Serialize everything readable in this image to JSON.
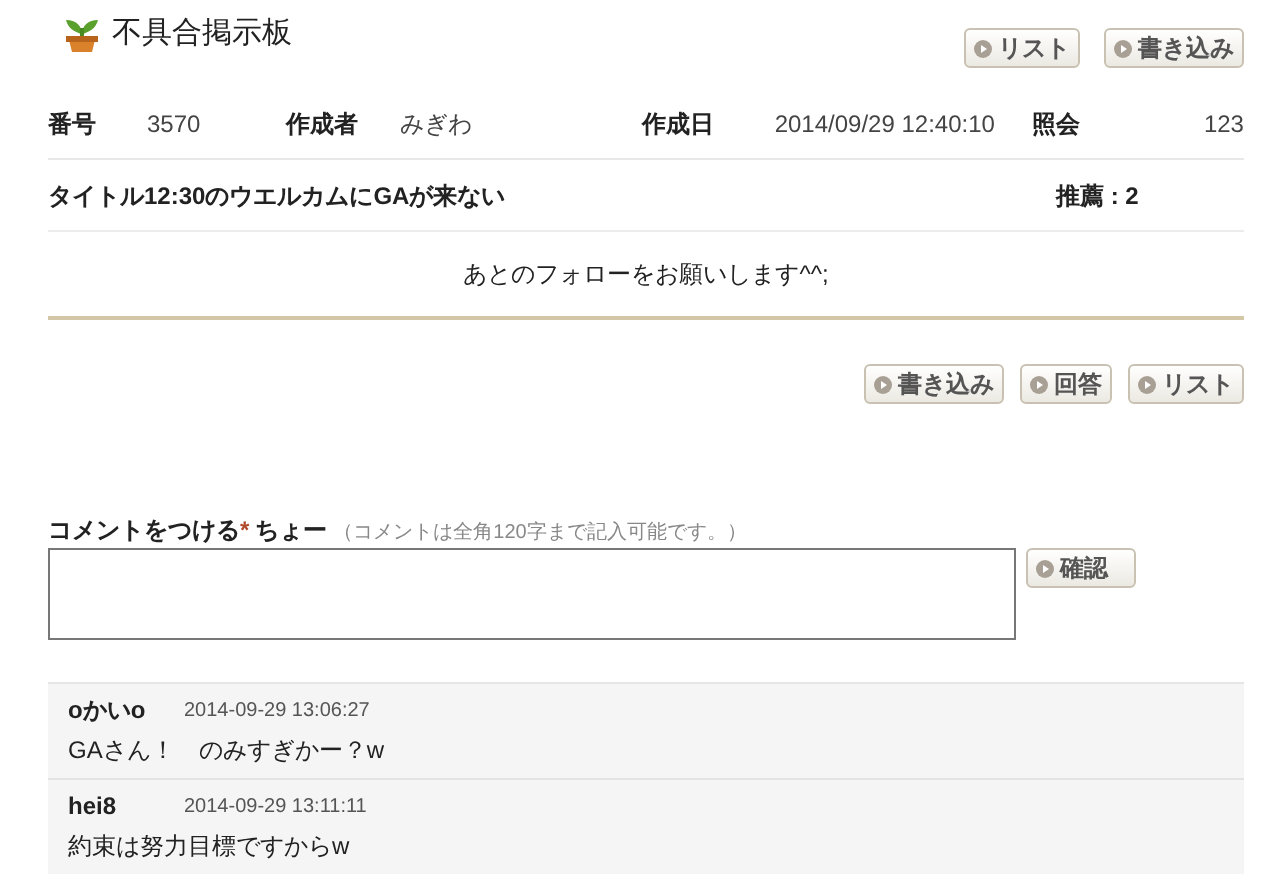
{
  "board": {
    "title": "不具合掲示板"
  },
  "top_buttons": [
    "リスト",
    "書き込み"
  ],
  "info": [
    {
      "label": "番号",
      "value": "3570"
    },
    {
      "label": "作成者",
      "value": "みぎわ"
    },
    {
      "label": "作成日",
      "value": "2014/09/29 12:40:10"
    },
    {
      "label": "照会",
      "value": "123"
    }
  ],
  "post": {
    "title_label": "タイトル",
    "title": "12:30のウエルカムにGAが来ない",
    "recommend": "推薦 : 2",
    "body": "あとのフォローをお願いします^^;"
  },
  "bottom_buttons": [
    "書き込み",
    "回答",
    "リスト"
  ],
  "comment_form": {
    "label": "コメントをつける",
    "required_mark": "*",
    "user": "ちょー",
    "hint": "（コメントは全角120字まで記入可能です。）",
    "button": "確認"
  },
  "comments": [
    {
      "author": "oかいo",
      "time": "2014-09-29 13:06:27",
      "text": "GAさん！　のみすぎかー？w"
    },
    {
      "author": "hei8",
      "time": "2014-09-29 13:11:11",
      "text": "約束は努力目標ですからw"
    }
  ]
}
